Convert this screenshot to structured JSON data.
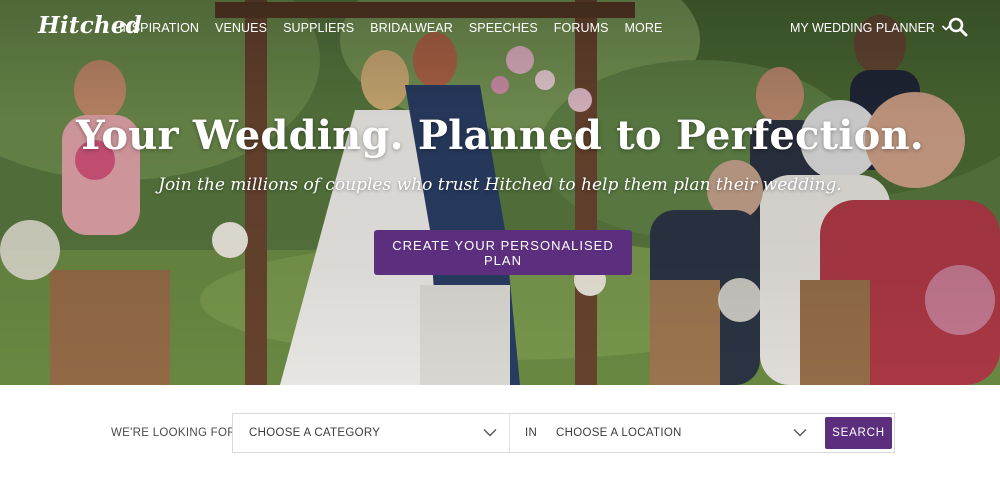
{
  "brand": {
    "logo_text": "Hitched",
    "accent_color": "#5b2f7e"
  },
  "nav": {
    "items": [
      {
        "label": "INSPIRATION"
      },
      {
        "label": "VENUES"
      },
      {
        "label": "SUPPLIERS"
      },
      {
        "label": "BRIDALWEAR"
      },
      {
        "label": "SPEECHES"
      },
      {
        "label": "FORUMS"
      },
      {
        "label": "MORE"
      }
    ],
    "planner_label": "MY WEDDING PLANNER",
    "planner_icon": "chevron-down-icon",
    "search_icon": "search-icon"
  },
  "hero": {
    "title": "Your Wedding. Planned to Perfection.",
    "subtitle": "Join the millions of couples who trust Hitched to help them plan their wedding.",
    "cta_label": "CREATE YOUR PERSONALISED PLAN"
  },
  "search": {
    "prefix_label": "WE'RE LOOKING FOR",
    "category_value": "CHOOSE A CATEGORY",
    "in_label": "IN",
    "location_value": "CHOOSE A LOCATION",
    "button_label": "SEARCH"
  }
}
